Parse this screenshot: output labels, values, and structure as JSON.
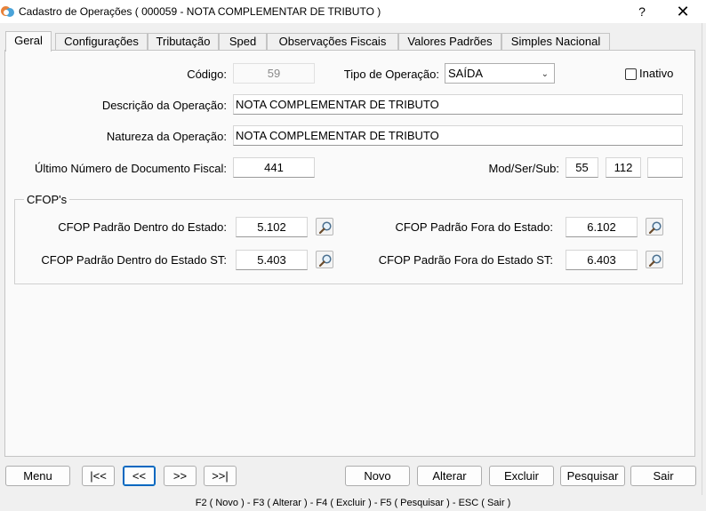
{
  "window": {
    "title": "Cadastro de Operações ( 000059 - NOTA COMPLEMENTAR DE TRIBUTO )",
    "help_label": "?",
    "close_label": "✕"
  },
  "tabs": [
    {
      "label": "Geral",
      "active": true
    },
    {
      "label": "Configurações"
    },
    {
      "label": "Tributação"
    },
    {
      "label": "Sped"
    },
    {
      "label": "Observações Fiscais"
    },
    {
      "label": "Valores Padrões"
    },
    {
      "label": "Simples Nacional"
    }
  ],
  "form": {
    "codigo_label": "Código:",
    "codigo_value": "59",
    "tipo_label": "Tipo de Operação:",
    "tipo_value": "SAÍDA",
    "inativo_label": "Inativo",
    "inativo_checked": false,
    "descricao_label": "Descrição da Operação:",
    "descricao_value": "NOTA COMPLEMENTAR DE TRIBUTO",
    "natureza_label": "Natureza da Operação:",
    "natureza_value": "NOTA COMPLEMENTAR DE TRIBUTO",
    "ultimo_label": "Último Número de Documento Fiscal:",
    "ultimo_value": "441",
    "modsersub_label": "Mod/Ser/Sub:",
    "mod_value": "55",
    "ser_value": "112",
    "sub_value": ""
  },
  "cfops": {
    "group_title": "CFOP's",
    "dentro_label": "CFOP Padrão Dentro do Estado:",
    "dentro_value": "5.102",
    "fora_label": "CFOP Padrão Fora do Estado:",
    "fora_value": "6.102",
    "dentro_st_label": "CFOP Padrão Dentro do Estado ST:",
    "dentro_st_value": "5.403",
    "fora_st_label": "CFOP Padrão Fora do Estado ST:",
    "fora_st_value": "6.403"
  },
  "buttons": {
    "menu": "Menu",
    "first": "|<<",
    "prev": "<<",
    "next": ">>",
    "last": ">>|",
    "novo": "Novo",
    "alterar": "Alterar",
    "excluir": "Excluir",
    "pesquisar": "Pesquisar",
    "sair": "Sair"
  },
  "status": {
    "shortcuts": "F2 ( Novo )  -  F3 ( Alterar )  -  F4 ( Excluir )  -  F5 ( Pesquisar )  -  ESC ( Sair )"
  },
  "icons": {
    "app": "app-icon",
    "search": "magnifier-icon",
    "dropdown": "chevron-down-icon"
  },
  "colors": {
    "focus_border": "#0067c0",
    "panel_bg": "#fafafa",
    "window_bg": "#f0f0f0"
  }
}
